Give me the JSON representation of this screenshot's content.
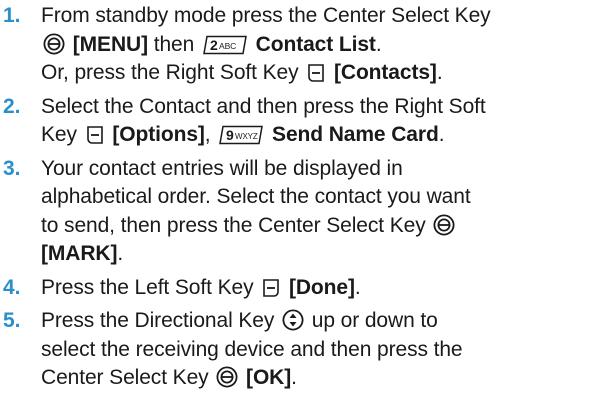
{
  "steps": [
    {
      "num": "1.",
      "l1_a": "From standby mode press the Center Select Key",
      "l2_b": "[MENU]",
      "l2_c": " then ",
      "l2_key": "2ABC",
      "l2_d": "Contact List",
      "l2_e": ".",
      "l3_a": "Or, press the Right Soft Key ",
      "l3_b": "[Contacts]",
      "l3_c": "."
    },
    {
      "num": "2.",
      "l1_a": "Select the Contact and then press the Right Soft",
      "l2_a": "Key ",
      "l2_b": "[Options]",
      "l2_c": ", ",
      "l2_key": "9WXYZ",
      "l2_d": "Send Name Card",
      "l2_e": "."
    },
    {
      "num": "3.",
      "l1_a": "Your contact entries will be displayed in",
      "l2_a": "alphabetical order. Select the contact you want",
      "l3_a": "to send, then press the Center Select Key",
      "l4_b": "[MARK]",
      "l4_c": "."
    },
    {
      "num": "4.",
      "l1_a": "Press the Left Soft Key ",
      "l1_b": "[Done]",
      "l1_c": "."
    },
    {
      "num": "5.",
      "l1_a": "Press the Directional Key ",
      "l1_b": " up or down to",
      "l2_a": "select the receiving device and then press the",
      "l3_a": "Center Select Key ",
      "l3_b": "[OK]",
      "l3_c": "."
    }
  ]
}
